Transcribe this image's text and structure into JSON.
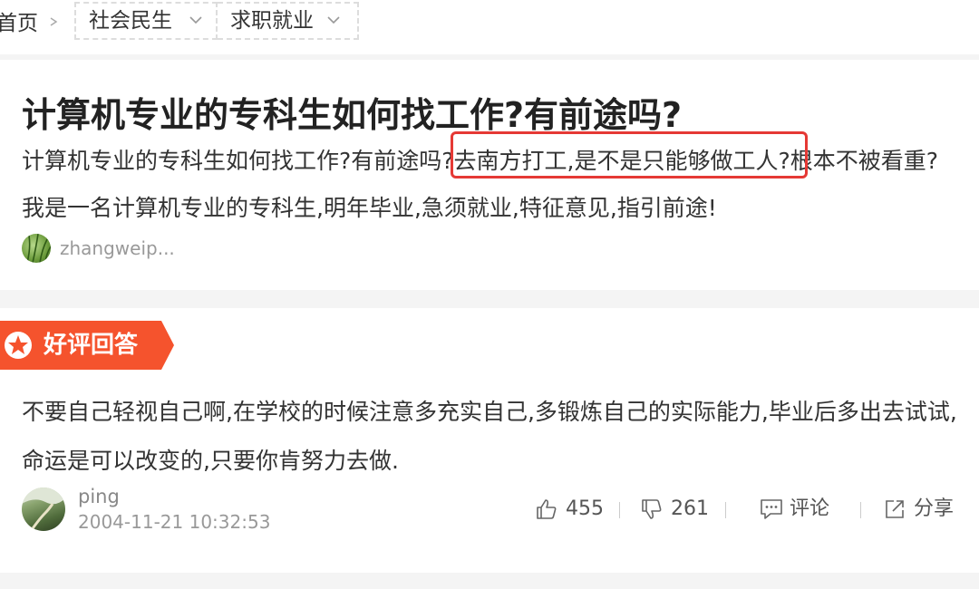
{
  "breadcrumb": {
    "home": "首页",
    "category": "社会民生",
    "subcategory": "求职就业"
  },
  "question": {
    "title": "计算机专业的专科生如何找工作?有前途吗?",
    "description": "计算机专业的专科生如何找工作?有前途吗?去南方打工,是不是只能够做工人?根本不被看重?我是一名计算机专业的专科生,明年毕业,急须就业,特征意见,指引前途!",
    "asker": "zhangweip..."
  },
  "answer": {
    "badge": "好评回答",
    "text": "不要自己轻视自己啊,在学校的时候注意多充实自己,多锻炼自己的实际能力,毕业后多出去试试,命运是可以改变的,只要你肯努力去做.",
    "author": "ping",
    "time": "2004-11-21 10:32:53",
    "likes": "455",
    "dislikes": "261",
    "comment_label": "评论",
    "share_label": "分享"
  },
  "colors": {
    "badge": "#f5532d",
    "highlight": "#e53935"
  }
}
